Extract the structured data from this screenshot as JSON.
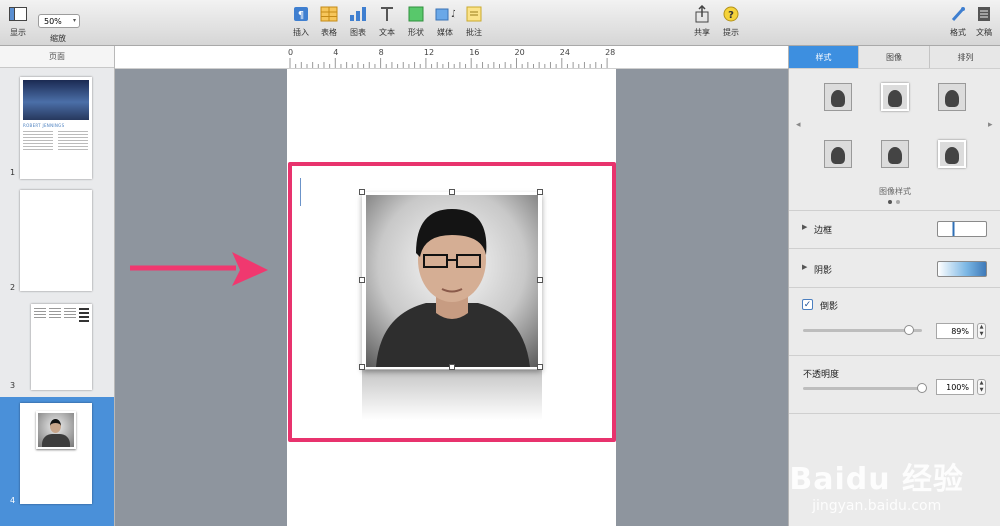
{
  "toolbar": {
    "view_label": "显示",
    "zoom_value": "50%",
    "zoom_label": "缩放",
    "insert_label": "插入",
    "table_label": "表格",
    "chart_label": "图表",
    "text_label": "文本",
    "shape_label": "形状",
    "media_label": "媒体",
    "comment_label": "批注",
    "share_label": "共享",
    "tips_label": "提示",
    "format_label": "格式",
    "document_label": "文稿"
  },
  "sidebar": {
    "header": "页面",
    "pages": [
      {
        "number": "1",
        "title_text": "ROBERT JENNINGS"
      },
      {
        "number": "2"
      },
      {
        "number": "3"
      },
      {
        "number": "4"
      }
    ]
  },
  "ruler": {
    "ticks": [
      "0",
      "4",
      "8",
      "12",
      "16",
      "20",
      "24",
      "28"
    ]
  },
  "inspector": {
    "tabs": [
      "样式",
      "图像",
      "排列"
    ],
    "active_tab": "样式",
    "image_styles_label": "图像样式",
    "border_label": "边框",
    "shadow_label": "阴影",
    "reflection_label": "倒影",
    "reflection_checked": true,
    "reflection_value": "89%",
    "reflection_level": 0.89,
    "opacity_label": "不透明度",
    "opacity_value": "100%",
    "opacity_level": 1.0
  },
  "watermark": {
    "brand": "Baidu 经验",
    "url": "jingyan.baidu.com"
  },
  "colors": {
    "highlight": "#e8336d",
    "accent": "#4a90d9",
    "arrow": "#f0386f"
  }
}
